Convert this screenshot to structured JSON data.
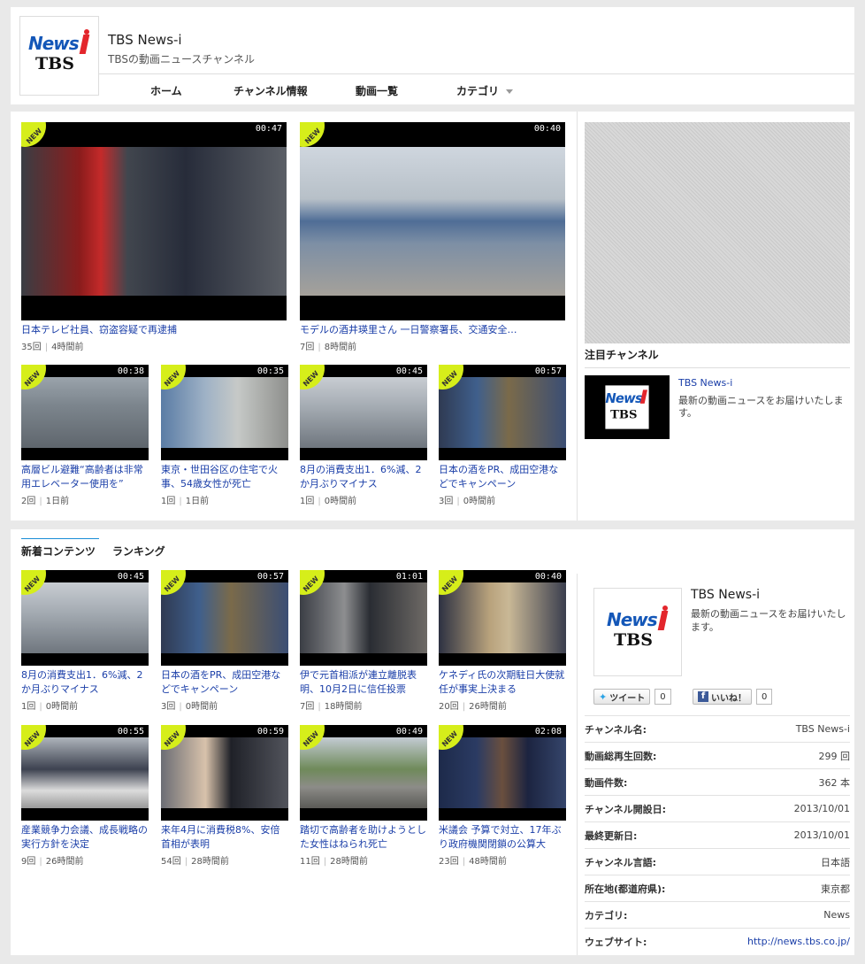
{
  "header": {
    "logo_text_news": "News",
    "logo_text_tbs": "TBS",
    "title": "TBS News-i",
    "subtitle": "TBSの動画ニュースチャンネル",
    "nav": [
      {
        "label": "ホーム"
      },
      {
        "label": "チャンネル情報"
      },
      {
        "label": "動画一覧"
      },
      {
        "label": "カテゴリ"
      }
    ]
  },
  "badge_text": "NEW",
  "top_videos": [
    {
      "title": "日本テレビ社員、窃盗容疑で再逮捕",
      "duration": "00:47",
      "views": "35回",
      "age": "4時間前"
    },
    {
      "title": "モデルの酒井瑛里さん 一日警察署長、交通安全…",
      "duration": "00:40",
      "views": "7回",
      "age": "8時間前"
    },
    {
      "title": "高層ビル避難“高齢者は非常用エレベーター使用を”",
      "duration": "00:38",
      "views": "2回",
      "age": "1日前"
    },
    {
      "title": "東京・世田谷区の住宅で火事、54歳女性が死亡",
      "duration": "00:35",
      "views": "1回",
      "age": "1日前"
    },
    {
      "title": "8月の消費支出1．6%減、2か月ぶりマイナス",
      "duration": "00:45",
      "views": "1回",
      "age": "0時間前"
    },
    {
      "title": "日本の酒をPR、成田空港などでキャンペーン",
      "duration": "00:57",
      "views": "3回",
      "age": "0時間前"
    }
  ],
  "featured": {
    "heading": "注目チャンネル",
    "name": "TBS News-i",
    "desc": "最新の動画ニュースをお届けいたします。"
  },
  "tabs": [
    {
      "label": "新着コンテンツ"
    },
    {
      "label": "ランキング"
    }
  ],
  "new_videos": [
    {
      "title": "8月の消費支出1．6%減、2か月ぶりマイナス",
      "duration": "00:45",
      "views": "1回",
      "age": "0時間前"
    },
    {
      "title": "日本の酒をPR、成田空港などでキャンペーン",
      "duration": "00:57",
      "views": "3回",
      "age": "0時間前"
    },
    {
      "title": "伊で元首相派が連立離脱表明、10月2日に信任投票",
      "duration": "01:01",
      "views": "7回",
      "age": "18時間前"
    },
    {
      "title": "ケネディ氏の次期駐日大使就任が事実上決まる",
      "duration": "00:40",
      "views": "20回",
      "age": "26時間前"
    },
    {
      "title": "産業競争力会議、成長戦略の実行方針を決定",
      "duration": "00:55",
      "views": "9回",
      "age": "26時間前"
    },
    {
      "title": "来年4月に消費税8%、安倍首相が表明",
      "duration": "00:59",
      "views": "54回",
      "age": "28時間前"
    },
    {
      "title": "踏切で高齢者を助けようとした女性はねられ死亡",
      "duration": "00:49",
      "views": "11回",
      "age": "28時間前"
    },
    {
      "title": "米議会 予算で対立、17年ぶり政府機関閉鎖の公算大",
      "duration": "02:08",
      "views": "23回",
      "age": "48時間前"
    }
  ],
  "channel_info": {
    "title": "TBS News-i",
    "desc": "最新の動画ニュースをお届けいたします。",
    "tweet_label": "ツイート",
    "tweet_count": "0",
    "like_label": "いいね！",
    "like_count": "0",
    "fb_glyph": "f",
    "rows": [
      {
        "k": "チャンネル名:",
        "v": "TBS News-i"
      },
      {
        "k": "動画総再生回数:",
        "v": "299 回"
      },
      {
        "k": "動画件数:",
        "v": "362 本"
      },
      {
        "k": "チャンネル開設日:",
        "v": "2013/10/01"
      },
      {
        "k": "最終更新日:",
        "v": "2013/10/01"
      },
      {
        "k": "チャンネル言語:",
        "v": "日本語"
      },
      {
        "k": "所在地(都道府県):",
        "v": "東京都"
      },
      {
        "k": "カテゴリ:",
        "v": "News"
      },
      {
        "k": "ウェブサイト:",
        "v": "http://news.tbs.co.jp/"
      }
    ]
  },
  "colors": {
    "link": "#1a3ea8",
    "badge": "#d6ee1a",
    "tab_accent": "#1a8ed6"
  }
}
